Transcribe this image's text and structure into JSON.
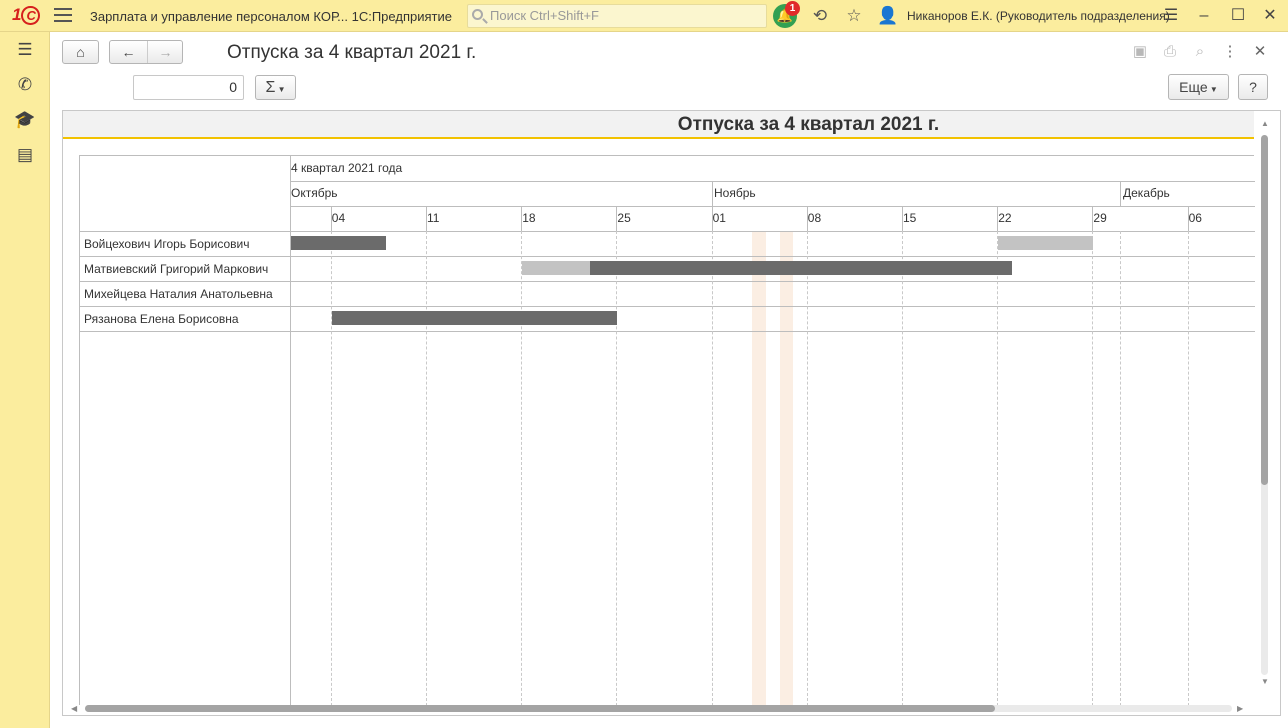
{
  "titlebar": {
    "app_title": "Зарплата и управление персоналом КОР...  1С:Предприятие",
    "search_placeholder": "Поиск Ctrl+Shift+F",
    "notifications_count": "1",
    "user": "Никаноров Е.К. (Руководитель подразделения)"
  },
  "form": {
    "title": "Отпуска за 4 квартал 2021 г.",
    "number_value": "0",
    "sum_label": "Σ",
    "more_label": "Еще",
    "help_label": "?"
  },
  "report": {
    "title": "Отпуска за 4 квартал 2021 г.",
    "quarter_label": "4 квартал 2021 года",
    "months": [
      "Октябрь",
      "Ноябрь",
      "Декабрь"
    ],
    "weeks": [
      "04",
      "11",
      "18",
      "25",
      "01",
      "08",
      "15",
      "22",
      "29",
      "06"
    ],
    "employees": [
      "Войцехович Игорь Борисович",
      "Матвиевский Григорий Маркович",
      "Михейцева Наталия Анатольевна",
      "Рязанова Елена Борисовна"
    ]
  },
  "chart_data": {
    "type": "gantt",
    "start_date": "2021-10-01",
    "holidays": [
      "2021-11-04",
      "2021-11-05",
      "2021-11-06"
    ],
    "bars": [
      {
        "employee": 0,
        "start": "2021-10-01",
        "end": "2021-10-07",
        "shade": "dark"
      },
      {
        "employee": 0,
        "start": "2021-11-22",
        "end": "2021-11-28",
        "shade": "light"
      },
      {
        "employee": 1,
        "start": "2021-10-18",
        "end": "2021-10-22",
        "shade": "light"
      },
      {
        "employee": 1,
        "start": "2021-10-23",
        "end": "2021-11-22",
        "shade": "dark"
      },
      {
        "employee": 3,
        "start": "2021-10-04",
        "end": "2021-10-24",
        "shade": "dark"
      }
    ],
    "colors": {
      "dark": "#6b6b6b",
      "light": "#c3c3c3",
      "holiday": "#fbeee3"
    }
  }
}
